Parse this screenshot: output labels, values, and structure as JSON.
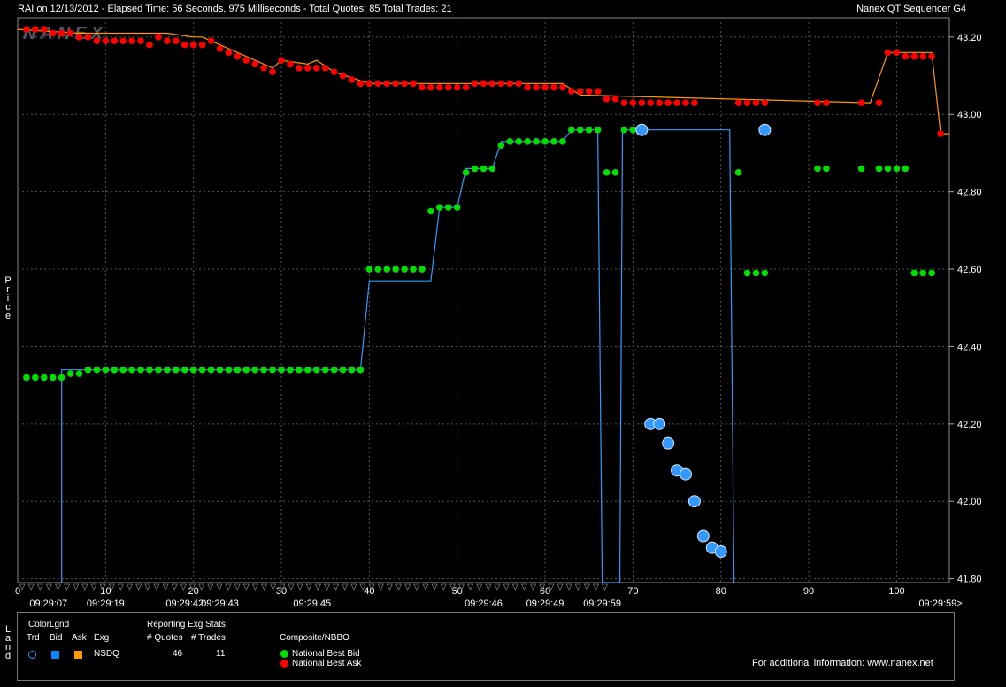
{
  "header": {
    "left": "RAI on 12/13/2012  -  Elapsed Time: 56 Seconds, 975 Milliseconds  -  Total Quotes: 85  Total Trades: 21",
    "right": "Nanex QT Sequencer G4"
  },
  "watermark": "NANEX",
  "side_labels": {
    "price": "Price",
    "land": "Land"
  },
  "colors": {
    "bid": "#00dd00",
    "ask": "#ff0000",
    "trade": "#3399ff",
    "ask_line": "#ff9900",
    "grid": "#555555"
  },
  "legend": {
    "title": "ColorLgnd",
    "cols": [
      "Trd",
      "Bid",
      "Ask",
      "Exg"
    ],
    "exchange": "NSDQ",
    "stats_title": "Reporting Exg Stats",
    "stats_cols": [
      "# Quotes",
      "# Trades"
    ],
    "quotes": "46",
    "trades": "11",
    "composite_title": "Composite/NBBO",
    "nbb": "National Best Bid",
    "nbo": "National Best Ask",
    "footer": "For additional information: www.nanex.net"
  },
  "chart_data": {
    "type": "scatter",
    "x_ticks": [
      0,
      10,
      20,
      30,
      40,
      50,
      60,
      70,
      80,
      90,
      100
    ],
    "xlim": [
      0,
      106
    ],
    "y_ticks": [
      "43.20",
      "43.00",
      "42.80",
      "42.60",
      "42.40",
      "42.20",
      "42.00",
      "41.80"
    ],
    "ylim": [
      41.79,
      43.25
    ],
    "time_labels": [
      {
        "x": 3.5,
        "label": "09:29:07"
      },
      {
        "x": 10,
        "label": "09:29:19"
      },
      {
        "x": 19,
        "label": "09:29:42"
      },
      {
        "x": 23,
        "label": "09:29:43"
      },
      {
        "x": 33.5,
        "label": "09:29:45"
      },
      {
        "x": 53,
        "label": "09:29:46"
      },
      {
        "x": 60,
        "label": "09:29:49"
      },
      {
        "x": 66.5,
        "label": "09:29:59"
      },
      {
        "x": 105,
        "label": "09:29:59>"
      }
    ],
    "series": [
      {
        "key": "bid",
        "points": [
          [
            1,
            42.32
          ],
          [
            2,
            42.32
          ],
          [
            3,
            42.32
          ],
          [
            4,
            42.32
          ],
          [
            5,
            42.32
          ],
          [
            6,
            42.33
          ],
          [
            7,
            42.33
          ],
          [
            8,
            42.34
          ],
          [
            9,
            42.34
          ],
          [
            10,
            42.34
          ],
          [
            11,
            42.34
          ],
          [
            12,
            42.34
          ],
          [
            13,
            42.34
          ],
          [
            14,
            42.34
          ],
          [
            15,
            42.34
          ],
          [
            16,
            42.34
          ],
          [
            17,
            42.34
          ],
          [
            18,
            42.34
          ],
          [
            19,
            42.34
          ],
          [
            20,
            42.34
          ],
          [
            21,
            42.34
          ],
          [
            22,
            42.34
          ],
          [
            23,
            42.34
          ],
          [
            24,
            42.34
          ],
          [
            25,
            42.34
          ],
          [
            26,
            42.34
          ],
          [
            27,
            42.34
          ],
          [
            28,
            42.34
          ],
          [
            29,
            42.34
          ],
          [
            30,
            42.34
          ],
          [
            31,
            42.34
          ],
          [
            32,
            42.34
          ],
          [
            33,
            42.34
          ],
          [
            34,
            42.34
          ],
          [
            35,
            42.34
          ],
          [
            36,
            42.34
          ],
          [
            37,
            42.34
          ],
          [
            38,
            42.34
          ],
          [
            39,
            42.34
          ],
          [
            40,
            42.6
          ],
          [
            41,
            42.6
          ],
          [
            42,
            42.6
          ],
          [
            43,
            42.6
          ],
          [
            44,
            42.6
          ],
          [
            45,
            42.6
          ],
          [
            46,
            42.6
          ],
          [
            47,
            42.75
          ],
          [
            48,
            42.76
          ],
          [
            49,
            42.76
          ],
          [
            50,
            42.76
          ],
          [
            51,
            42.85
          ],
          [
            52,
            42.86
          ],
          [
            53,
            42.86
          ],
          [
            54,
            42.86
          ],
          [
            55,
            42.92
          ],
          [
            56,
            42.93
          ],
          [
            57,
            42.93
          ],
          [
            58,
            42.93
          ],
          [
            59,
            42.93
          ],
          [
            60,
            42.93
          ],
          [
            61,
            42.93
          ],
          [
            62,
            42.93
          ],
          [
            63,
            42.96
          ],
          [
            64,
            42.96
          ],
          [
            65,
            42.96
          ],
          [
            66,
            42.96
          ],
          [
            67,
            42.85
          ],
          [
            68,
            42.85
          ],
          [
            69,
            42.96
          ],
          [
            70,
            42.96
          ],
          [
            71,
            42.96
          ],
          [
            82,
            42.85
          ],
          [
            83,
            42.59
          ],
          [
            84,
            42.59
          ],
          [
            85,
            42.59
          ],
          [
            91,
            42.86
          ],
          [
            92,
            42.86
          ],
          [
            96,
            42.86
          ],
          [
            98,
            42.86
          ],
          [
            99,
            42.86
          ],
          [
            100,
            42.86
          ],
          [
            101,
            42.86
          ],
          [
            102,
            42.59
          ],
          [
            103,
            42.59
          ],
          [
            104,
            42.59
          ]
        ]
      },
      {
        "key": "ask",
        "points": [
          [
            1,
            43.22
          ],
          [
            2,
            43.22
          ],
          [
            3,
            43.22
          ],
          [
            4,
            43.21
          ],
          [
            5,
            43.21
          ],
          [
            6,
            43.21
          ],
          [
            7,
            43.2
          ],
          [
            8,
            43.2
          ],
          [
            9,
            43.19
          ],
          [
            10,
            43.19
          ],
          [
            11,
            43.19
          ],
          [
            12,
            43.19
          ],
          [
            13,
            43.19
          ],
          [
            14,
            43.19
          ],
          [
            15,
            43.18
          ],
          [
            16,
            43.2
          ],
          [
            17,
            43.19
          ],
          [
            18,
            43.19
          ],
          [
            19,
            43.18
          ],
          [
            20,
            43.18
          ],
          [
            21,
            43.18
          ],
          [
            22,
            43.19
          ],
          [
            23,
            43.17
          ],
          [
            24,
            43.16
          ],
          [
            25,
            43.15
          ],
          [
            26,
            43.14
          ],
          [
            27,
            43.13
          ],
          [
            28,
            43.12
          ],
          [
            29,
            43.11
          ],
          [
            30,
            43.14
          ],
          [
            31,
            43.13
          ],
          [
            32,
            43.12
          ],
          [
            33,
            43.12
          ],
          [
            34,
            43.12
          ],
          [
            35,
            43.12
          ],
          [
            36,
            43.11
          ],
          [
            37,
            43.1
          ],
          [
            38,
            43.09
          ],
          [
            39,
            43.08
          ],
          [
            40,
            43.08
          ],
          [
            41,
            43.08
          ],
          [
            42,
            43.08
          ],
          [
            43,
            43.08
          ],
          [
            44,
            43.08
          ],
          [
            45,
            43.08
          ],
          [
            46,
            43.07
          ],
          [
            47,
            43.07
          ],
          [
            48,
            43.07
          ],
          [
            49,
            43.07
          ],
          [
            50,
            43.07
          ],
          [
            51,
            43.07
          ],
          [
            52,
            43.08
          ],
          [
            53,
            43.08
          ],
          [
            54,
            43.08
          ],
          [
            55,
            43.08
          ],
          [
            56,
            43.08
          ],
          [
            57,
            43.08
          ],
          [
            58,
            43.07
          ],
          [
            59,
            43.07
          ],
          [
            60,
            43.07
          ],
          [
            61,
            43.07
          ],
          [
            62,
            43.07
          ],
          [
            63,
            43.06
          ],
          [
            64,
            43.06
          ],
          [
            65,
            43.06
          ],
          [
            66,
            43.06
          ],
          [
            67,
            43.04
          ],
          [
            68,
            43.04
          ],
          [
            69,
            43.03
          ],
          [
            70,
            43.03
          ],
          [
            71,
            43.03
          ],
          [
            72,
            43.03
          ],
          [
            73,
            43.03
          ],
          [
            74,
            43.03
          ],
          [
            75,
            43.03
          ],
          [
            76,
            43.03
          ],
          [
            77,
            43.03
          ],
          [
            82,
            43.03
          ],
          [
            83,
            43.03
          ],
          [
            84,
            43.03
          ],
          [
            85,
            43.03
          ],
          [
            91,
            43.03
          ],
          [
            92,
            43.03
          ],
          [
            96,
            43.03
          ],
          [
            98,
            43.03
          ],
          [
            99,
            43.16
          ],
          [
            100,
            43.16
          ],
          [
            101,
            43.15
          ],
          [
            102,
            43.15
          ],
          [
            103,
            43.15
          ],
          [
            104,
            43.15
          ],
          [
            105,
            42.95
          ]
        ]
      },
      {
        "key": "trade",
        "points": [
          [
            71,
            42.96
          ],
          [
            72,
            42.2
          ],
          [
            73,
            42.2
          ],
          [
            74,
            42.15
          ],
          [
            75,
            42.08
          ],
          [
            76,
            42.07
          ],
          [
            77,
            42.0
          ],
          [
            78,
            41.91
          ],
          [
            79,
            41.88
          ],
          [
            80,
            41.87
          ],
          [
            85,
            42.96
          ]
        ]
      }
    ],
    "bid_line": [
      [
        5,
        41.79
      ],
      [
        5,
        42.34
      ],
      [
        39,
        42.34
      ],
      [
        40,
        42.57
      ],
      [
        47,
        42.57
      ],
      [
        48,
        42.76
      ],
      [
        50,
        42.76
      ],
      [
        51,
        42.86
      ],
      [
        54,
        42.86
      ],
      [
        55,
        42.93
      ],
      [
        62,
        42.93
      ],
      [
        63,
        42.96
      ],
      [
        66,
        42.96
      ],
      [
        66.5,
        41.79
      ],
      [
        68.5,
        41.79
      ],
      [
        68.8,
        42.96
      ],
      [
        81,
        42.96
      ],
      [
        81.5,
        41.79
      ]
    ],
    "ask_line": [
      [
        0,
        43.22
      ],
      [
        7,
        43.21
      ],
      [
        17,
        43.21
      ],
      [
        20,
        43.2
      ],
      [
        21,
        43.2
      ],
      [
        29,
        43.12
      ],
      [
        30,
        43.14
      ],
      [
        33,
        43.13
      ],
      [
        34,
        43.14
      ],
      [
        36,
        43.11
      ],
      [
        40,
        43.08
      ],
      [
        62,
        43.08
      ],
      [
        64,
        43.05
      ],
      [
        97,
        43.03
      ],
      [
        99,
        43.16
      ],
      [
        104,
        43.16
      ],
      [
        105,
        42.95
      ],
      [
        106,
        42.95
      ]
    ]
  }
}
